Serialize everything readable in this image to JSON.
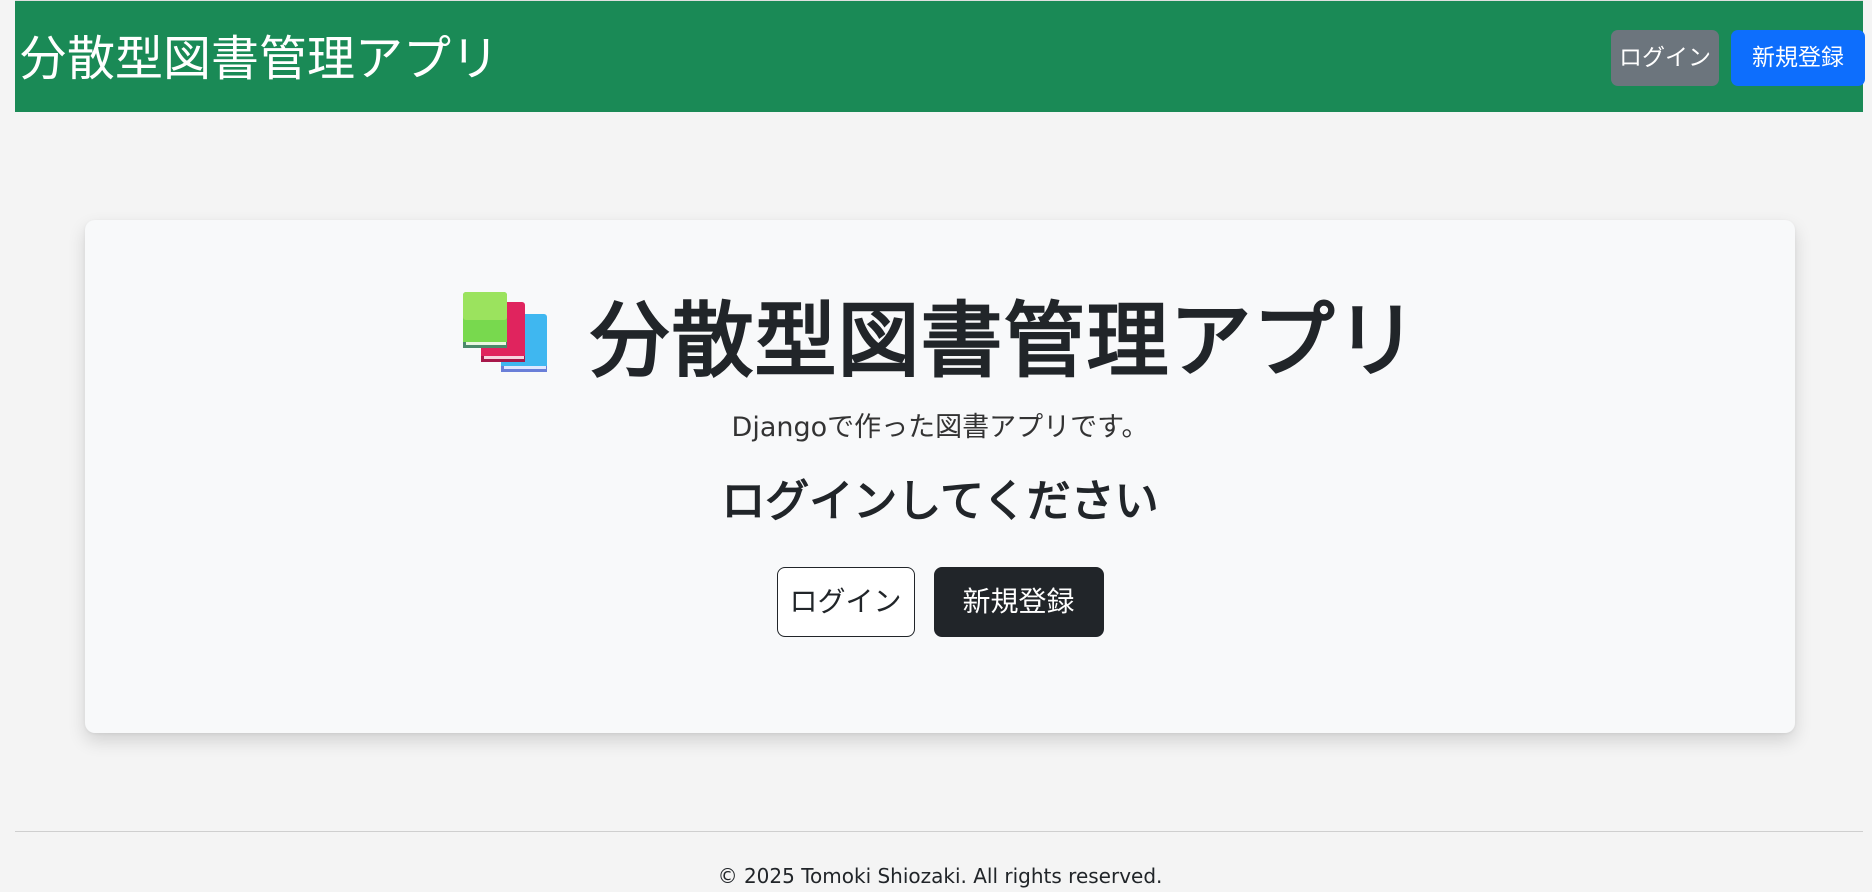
{
  "navbar": {
    "brand": "分散型図書管理アプリ",
    "login_label": "ログイン",
    "register_label": "新規登録",
    "background_color": "#1a8a56",
    "login_color": "#6c757d",
    "register_color": "#0d6efd"
  },
  "hero": {
    "icon": "books-icon",
    "title": "分散型図書管理アプリ",
    "subtitle": "Djangoで作った図書アプリです。",
    "prompt": "ログインしてください",
    "login_label": "ログイン",
    "register_label": "新規登録"
  },
  "footer": {
    "copyright": "© 2025 Tomoki Shiozaki. All rights reserved."
  }
}
